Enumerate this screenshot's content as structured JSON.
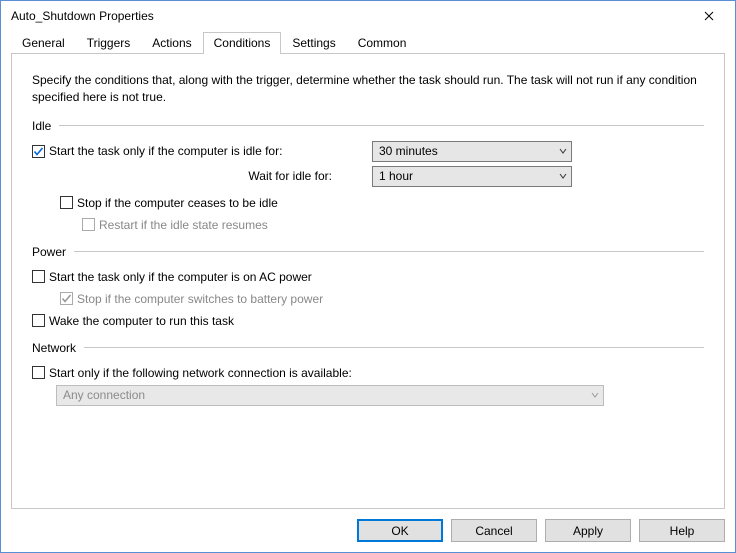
{
  "window": {
    "title": "Auto_Shutdown Properties"
  },
  "tabs": {
    "general": "General",
    "triggers": "Triggers",
    "actions": "Actions",
    "conditions": "Conditions",
    "settings": "Settings",
    "common": "Common",
    "active": "conditions"
  },
  "description": "Specify the conditions that, along with the trigger, determine whether the task should run. The task will not run if any condition specified here is not true.",
  "sections": {
    "idle": "Idle",
    "power": "Power",
    "network": "Network"
  },
  "idle": {
    "start_label": "Start the task only if the computer is idle for:",
    "start_checked": true,
    "start_value": "30 minutes",
    "wait_label": "Wait for idle for:",
    "wait_value": "1 hour",
    "stop_label": "Stop if the computer ceases to be idle",
    "stop_checked": false,
    "restart_label": "Restart if the idle state resumes",
    "restart_checked": false,
    "restart_enabled": false
  },
  "power": {
    "ac_label": "Start the task only if the computer is on AC power",
    "ac_checked": false,
    "stop_batt_label": "Stop if the computer switches to battery power",
    "stop_batt_checked": true,
    "stop_batt_enabled": false,
    "wake_label": "Wake the computer to run this task",
    "wake_checked": false
  },
  "network": {
    "start_label": "Start only if the following network connection is available:",
    "start_checked": false,
    "value": "Any connection",
    "enabled": false
  },
  "buttons": {
    "ok": "OK",
    "cancel": "Cancel",
    "apply": "Apply",
    "help": "Help"
  }
}
